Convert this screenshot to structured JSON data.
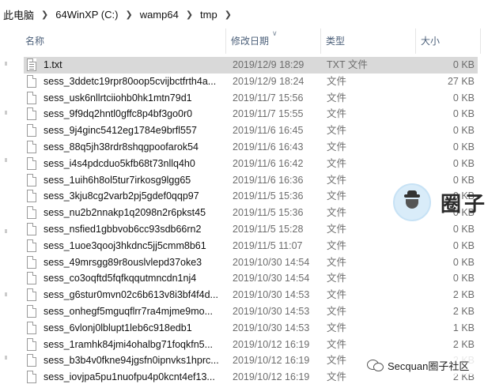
{
  "breadcrumb": [
    "此电脑",
    "64WinXP  (C:)",
    "wamp64",
    "tmp"
  ],
  "columns": {
    "name": "名称",
    "date": "修改日期",
    "type": "类型",
    "size": "大小"
  },
  "files": [
    {
      "name": "1.txt",
      "date": "2019/12/9 18:29",
      "type": "TXT 文件",
      "size": "0 KB",
      "icon": "txt",
      "selected": true
    },
    {
      "name": "sess_3ddetc19rpr80oop5cvijbctfrth4a...",
      "date": "2019/12/9 18:24",
      "type": "文件",
      "size": "27 KB"
    },
    {
      "name": "sess_usk6nllrtciiohb0hk1mtn79d1",
      "date": "2019/11/7 15:56",
      "type": "文件",
      "size": "0 KB"
    },
    {
      "name": "sess_9f9dq2hntl0gffc8p4bf3go0r0",
      "date": "2019/11/7 15:55",
      "type": "文件",
      "size": "0 KB"
    },
    {
      "name": "sess_9j4ginc5412eg1784e9brfl557",
      "date": "2019/11/6 16:45",
      "type": "文件",
      "size": "0 KB"
    },
    {
      "name": "sess_88q5jh38rdr8shqgpoofarok54",
      "date": "2019/11/6 16:43",
      "type": "文件",
      "size": "0 KB"
    },
    {
      "name": "sess_i4s4pdcduo5kfb68t73nllq4h0",
      "date": "2019/11/6 16:42",
      "type": "文件",
      "size": "0 KB"
    },
    {
      "name": "sess_1uih6h8ol5tur7irkosg9lgg65",
      "date": "2019/11/6 16:36",
      "type": "文件",
      "size": "0 KB"
    },
    {
      "name": "sess_3kju8cg2varb2pj5gdef0qqp97",
      "date": "2019/11/5 15:36",
      "type": "文件",
      "size": "0 KB"
    },
    {
      "name": "sess_nu2b2nnakp1q2098n2r6pkst45",
      "date": "2019/11/5 15:36",
      "type": "文件",
      "size": "0 KB"
    },
    {
      "name": "sess_nsfied1gbbvob6cc93sdb66rn2",
      "date": "2019/11/5 15:28",
      "type": "文件",
      "size": "0 KB"
    },
    {
      "name": "sess_1uoe3qooj3hkdnc5jj5cmm8b61",
      "date": "2019/11/5 11:07",
      "type": "文件",
      "size": "0 KB"
    },
    {
      "name": "sess_49mrsgg89r8ouslvlepd37oke3",
      "date": "2019/10/30 14:54",
      "type": "文件",
      "size": "0 KB"
    },
    {
      "name": "sess_co3oqftd5fqfkqqutmncdn1nj4",
      "date": "2019/10/30 14:54",
      "type": "文件",
      "size": "0 KB"
    },
    {
      "name": "sess_g6stur0mvn02c6b613v8i3bf4f4d...",
      "date": "2019/10/30 14:53",
      "type": "文件",
      "size": "2 KB"
    },
    {
      "name": "sess_onhegf5mguqflrr7ra4mjme9mo...",
      "date": "2019/10/30 14:53",
      "type": "文件",
      "size": "2 KB"
    },
    {
      "name": "sess_6vlonj0lblupt1leb6c918edb1",
      "date": "2019/10/30 14:53",
      "type": "文件",
      "size": "1 KB"
    },
    {
      "name": "sess_1ramhk84jmi4ohalbg71foqkfn5...",
      "date": "2019/10/12 16:19",
      "type": "文件",
      "size": "2 KB"
    },
    {
      "name": "sess_b3b4v0fkne94jgsfn0ipnvks1hprc...",
      "date": "2019/10/12 16:19",
      "type": "文件",
      "size": "2 KB"
    },
    {
      "name": "sess_iovjpa5pu1nuofpu4p0kcnt4ef13...",
      "date": "2019/10/12 16:19",
      "type": "文件",
      "size": "2 KB"
    }
  ],
  "watermark": {
    "logo_text": "圈子",
    "bottom_text": "Secquan圈子社区"
  }
}
